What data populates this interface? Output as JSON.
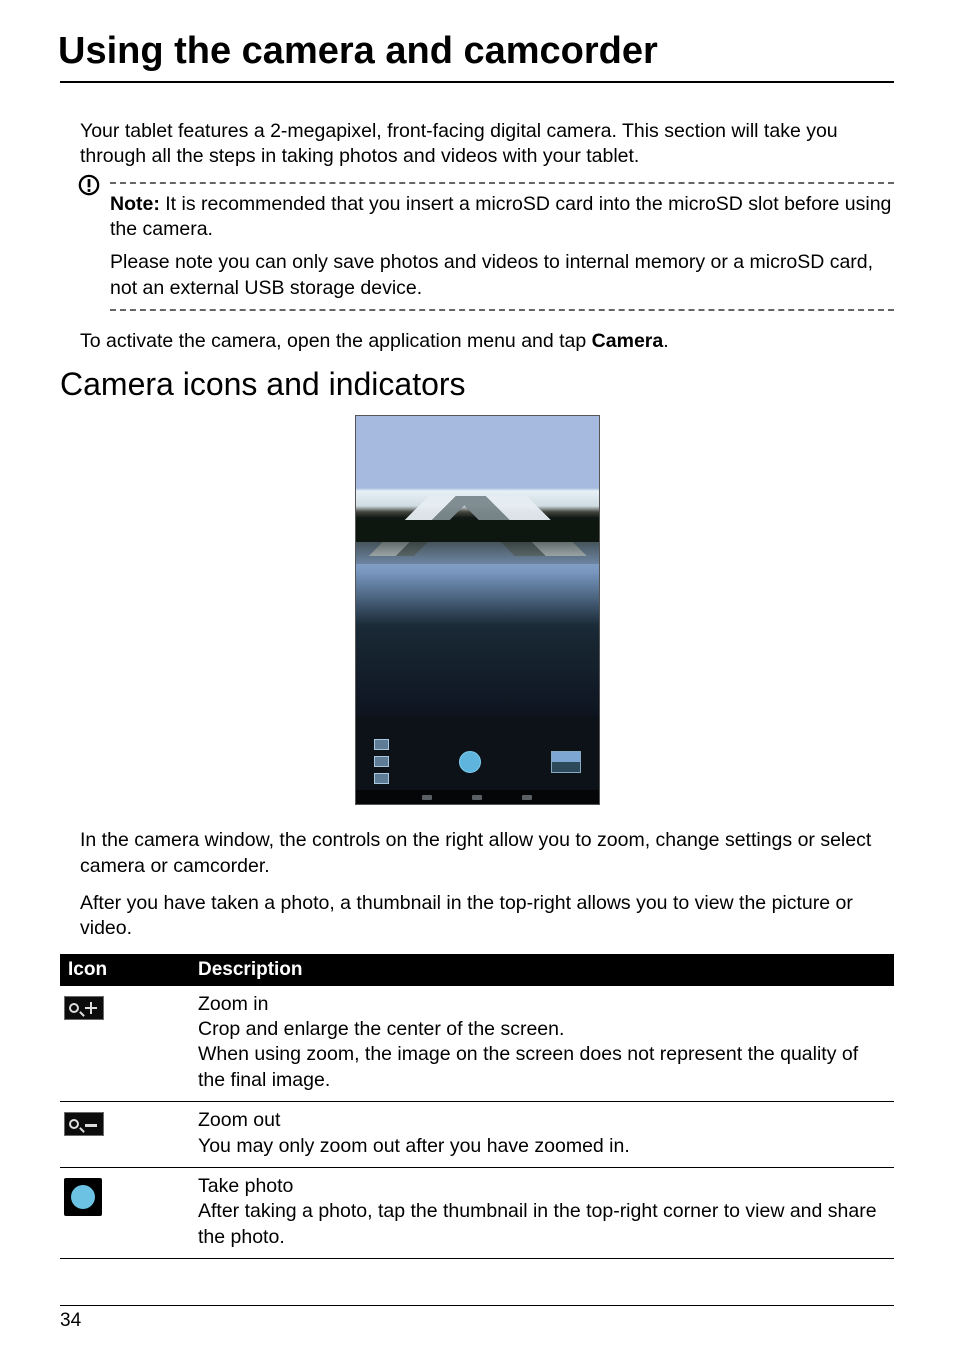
{
  "title": "Using the camera and camcorder",
  "intro": "Your tablet features a 2-megapixel, front-facing digital camera. This section will take you through all the steps in taking photos and videos with your tablet.",
  "note": {
    "label": "Note:",
    "line1": " It is recommended that you insert a microSD card into the microSD slot before using the camera.",
    "line2": "Please note you can only save photos and videos to internal memory or a microSD card, not an external USB storage device."
  },
  "activate_pre": "To activate the camera, open the application menu and tap ",
  "activate_bold": "Camera",
  "activate_post": ".",
  "section": "Camera icons and indicators",
  "para1": "In the camera window, the controls on the right allow you to zoom, change settings or select camera or camcorder.",
  "para2": "After you have taken a photo, a thumbnail in the top-right allows you to view the picture or video.",
  "table": {
    "h1": "Icon",
    "h2": "Description",
    "r1": {
      "t": "Zoom in",
      "d1": "Crop and enlarge the center of the screen.",
      "d2": "When using zoom, the image on the screen does not represent the quality of the final image."
    },
    "r2": {
      "t": "Zoom out",
      "d": "You may only zoom out after you have zoomed in."
    },
    "r3": {
      "t": "Take photo",
      "d": "After taking a photo, tap the thumbnail in the top-right corner to view and share the photo."
    }
  },
  "page": "34"
}
